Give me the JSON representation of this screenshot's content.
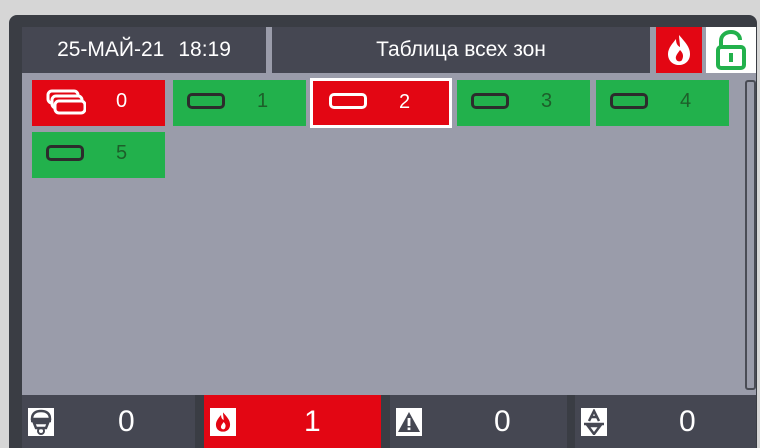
{
  "header": {
    "date": "25-МАЙ-21",
    "time": "18:19",
    "title": "Таблица всех зон",
    "fire_icon": "fire-icon",
    "lock_icon": "unlocked-lock-icon"
  },
  "colors": {
    "ok": "#22b14c",
    "alarm": "#e30613",
    "panel": "#454752",
    "background": "#9a9caa"
  },
  "zones": [
    {
      "number": "0",
      "status": "alarm",
      "icon": "all-zones-stack-icon"
    },
    {
      "number": "1",
      "status": "ok",
      "icon": "zone-icon"
    },
    {
      "number": "2",
      "status": "alarm",
      "icon": "zone-icon",
      "selected": true
    },
    {
      "number": "3",
      "status": "ok",
      "icon": "zone-icon"
    },
    {
      "number": "4",
      "status": "ok",
      "icon": "zone-icon"
    },
    {
      "number": "5",
      "status": "ok",
      "icon": "zone-icon"
    }
  ],
  "footer": {
    "detector_count": "0",
    "fire_count": "1",
    "fault_count": "0",
    "disabled_count": "0"
  }
}
